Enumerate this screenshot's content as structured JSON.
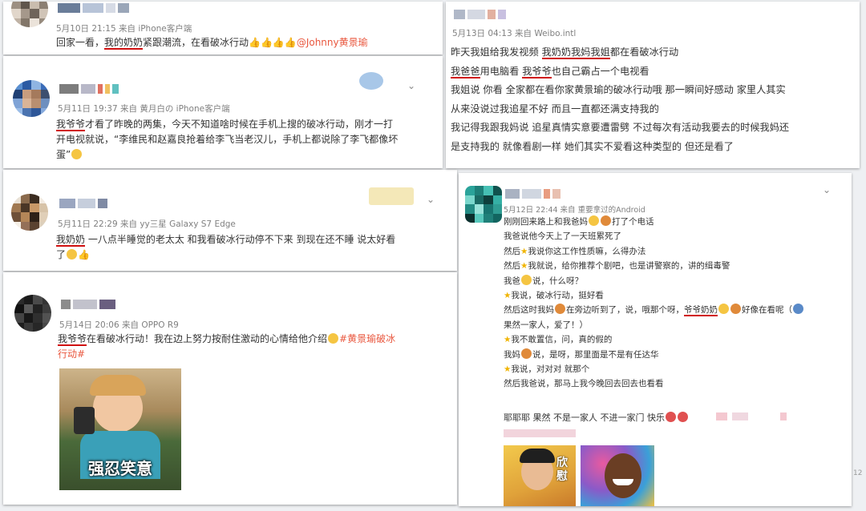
{
  "post1": {
    "meta": "5月10日 21:15 来自 iPhone客户端",
    "pre": "回家一看，",
    "hl": "我的奶奶",
    "post": "紧跟潮流，在看破冰行动",
    "mention": "@Johnny黄景瑜"
  },
  "post2": {
    "meta": "5月11日 19:37 来自 黄月白の iPhone客户端",
    "hl": "我爷爷",
    "line1_rest": "才看了昨晚的两集，今天不知道啥时候在手机上搜的破冰行动，刚才一打",
    "line2": "开电视就说，“李维民和赵嘉良抢着给李飞当老汉儿，手机上都说除了李飞都像坏",
    "line3": "蛋”"
  },
  "post3": {
    "meta": "5月11日 22:29 来自 yy三星 Galaxy S7 Edge",
    "hl": "我奶奶",
    "line1_rest": " 一八点半睡觉的老太太 和我看破冰行动停不下来 到现在还不睡 说太好看",
    "line2": "了"
  },
  "post4": {
    "meta": "5月14日 20:06 来自 OPPO R9",
    "hl": "我爷爷",
    "line1_rest": "在看破冰行动！我在边上努力按耐住激动的心情给他介绍",
    "tag1": "#黄景瑜破冰",
    "tag2": "行动#",
    "meme_caption": "强忍笑意"
  },
  "post5": {
    "meta": "5月13日 04:13 来自 Weibo.intl",
    "line1_pre": "昨天我姐给我发视频 ",
    "line1_hl": "我奶奶我妈我姐",
    "line1_post": "都在看破冰行动",
    "line2_hl1": "我爸爸",
    "line2_mid": "用电脑看 ",
    "line2_hl2": "我爷爷",
    "line2_post": "也自己霸占一个电视看",
    "line3": "我姐说 你看 全家都在看你家黄景瑜的破冰行动哦 那一瞬间好感动 家里人其实",
    "line4": "从来没说过我追星不好 而且一直都还满支持我的",
    "line5": "我记得我跟我妈说 追星真情实意要遭雷劈 不过每次有活动我要去的时候我妈还",
    "line6": "是支持我的 就像看剧一样 她们其实不爱看这种类型的 但还是看了"
  },
  "post6": {
    "meta": "5月12日 22:44 来自 重要拿过的Android",
    "lines": [
      "刚刚回来路上和我爸妈",
      "打了个电话",
      "我爸说他今天上了一天班累死了",
      "然后",
      "我说你这工作性质嘛，么得办法",
      "我就说，给你推荐个剧吧，也是讲警察的，讲的缉毒警",
      "我爸",
      "说，什么呀？",
      "我说，破冰行动，挺好看",
      "然后这时我妈",
      "在旁边听到了，说，哦那个呀，",
      "爷爷奶奶",
      "好像在看呢（",
      "果然一家人，爱了！）",
      "我不敢置信，问，真的假的",
      "我妈",
      "说，是呀，那里面是不是有任达华",
      "我说，对对对 就那个",
      "然后我爸说，那马上我今晚回去回去也看看"
    ],
    "footer": "耶耶耶 果然 不是一家人 不进一家门 快乐",
    "meme_caption": "欣慰"
  },
  "page_number": "12",
  "colors": {
    "highlight": "#d01010",
    "tag": "#e9573e",
    "meta": "#808080"
  }
}
